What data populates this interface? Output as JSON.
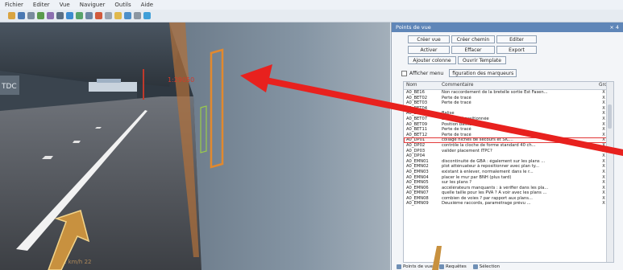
{
  "menu": [
    "Fichier",
    "Editer",
    "Vue",
    "Naviguer",
    "Outils",
    "Aide"
  ],
  "toolbar_icons": [
    "folder-icon",
    "save-icon",
    "move-icon",
    "rotate-icon",
    "scale-icon",
    "camera-icon",
    "pointer-icon",
    "layers-icon",
    "zoom-icon",
    "flag-icon",
    "measure-icon",
    "pencil-icon",
    "tag-icon",
    "settings-icon",
    "info-icon"
  ],
  "viewport": {
    "sign_text": "TDC",
    "marker_code": "1:29050",
    "speed": "1 km/h  22"
  },
  "panel": {
    "title": "Points de vue",
    "close": "× 4",
    "buttons_row1": [
      "Créer vue",
      "Créer chemin",
      "Editer"
    ],
    "buttons_row2": [
      "Activer",
      "Effacer",
      "Export"
    ],
    "buttons_row3": [
      "Ajouter colonne",
      "Ouvrir Template"
    ],
    "checkbox_label": "Afficher menu",
    "filter_button": "figuration des marqueurs"
  },
  "table": {
    "headers": [
      "Nom",
      "Commentaire",
      "Gro."
    ],
    "rows": [
      [
        "A0_BE16",
        "Non raccordement de la bretelle sortie Est Fasen...",
        "X"
      ],
      [
        "A0_BET02",
        "Perte de tracé",
        "X"
      ],
      [
        "A0_BET03",
        "Perte de tracé",
        "X"
      ],
      [
        "A0_BET04",
        "",
        "X"
      ],
      [
        "A0_BET05",
        "Balise",
        "X"
      ],
      [
        "A0_BET07",
        "Balise mal positionnée",
        "X"
      ],
      [
        "A0_BET09",
        "Position balise",
        "X"
      ],
      [
        "A0_BET11",
        "Perte de tracé",
        "X"
      ],
      [
        "A0_BET12",
        "Perte de tracé",
        "X"
      ],
      [
        "A0_DP01",
        "collage niches de secours et SIC...",
        "X"
      ],
      [
        "A0_DP02",
        "contrôle la cloche de forme standard 40 ch...",
        "X"
      ],
      [
        "A0_DP03",
        "valider placement ITPC?",
        "X"
      ],
      [
        "A0_DP04",
        "",
        "X"
      ],
      [
        "A0_EMN01",
        "discontinuité de GBA : également sur les plans ...",
        "X"
      ],
      [
        "A0_EMN02",
        "plot atténuateur à repositionner avec plan ty...",
        "X"
      ],
      [
        "A0_EMN03",
        "existant à enlever, normalement dans le r...",
        "X"
      ],
      [
        "A0_EMN04",
        "placer le mur par BNH (plus tard)",
        "X"
      ],
      [
        "A0_EMN05",
        "sur les plans ?",
        "X"
      ],
      [
        "A0_EMN06",
        "accélérateurs manquants : à vérifier dans les pla...",
        "X"
      ],
      [
        "A0_EMN07",
        "quelle taille pour les PVA ? A voir avec les plans ...",
        "X"
      ],
      [
        "A0_EMN08",
        "combien de voies ? par rapport aux plans...",
        "X"
      ],
      [
        "A0_EMN09",
        "Deuxième raccords, paramétrage prévu ...",
        "X"
      ]
    ],
    "selected_row": 9
  },
  "bottom_tabs": [
    "Points de vue",
    "Requêtes",
    "Sélection"
  ],
  "colors": {
    "selection": "#e23b3b",
    "callout_arrow": "#e8211e",
    "annotation_arrow": "#c8913f",
    "panel_title": "#5f86b8"
  }
}
